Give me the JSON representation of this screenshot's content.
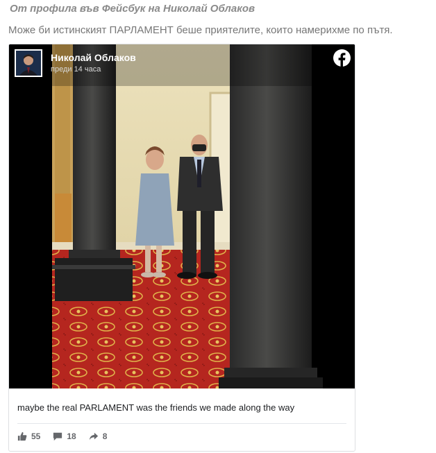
{
  "article": {
    "heading": "От профила във Фейсбук  на Николай Облаков",
    "subtitle": "Може би истинският ПАРЛАМЕНТ беше приятелите, които намерихме по пътя."
  },
  "post": {
    "author_name": "Николай Облаков",
    "time": "преди 14 часа",
    "caption": "maybe the real PARLAMENT was the friends we made along the way",
    "likes": "55",
    "comments": "18",
    "shares": "8"
  },
  "icons": {
    "platform": "facebook-icon",
    "like": "thumbs-up-icon",
    "comment": "comment-icon",
    "share": "share-icon"
  },
  "colors": {
    "carpet": "#b5261f",
    "wall": "#e8dcb4",
    "facebook_badge": "#ffffff"
  }
}
